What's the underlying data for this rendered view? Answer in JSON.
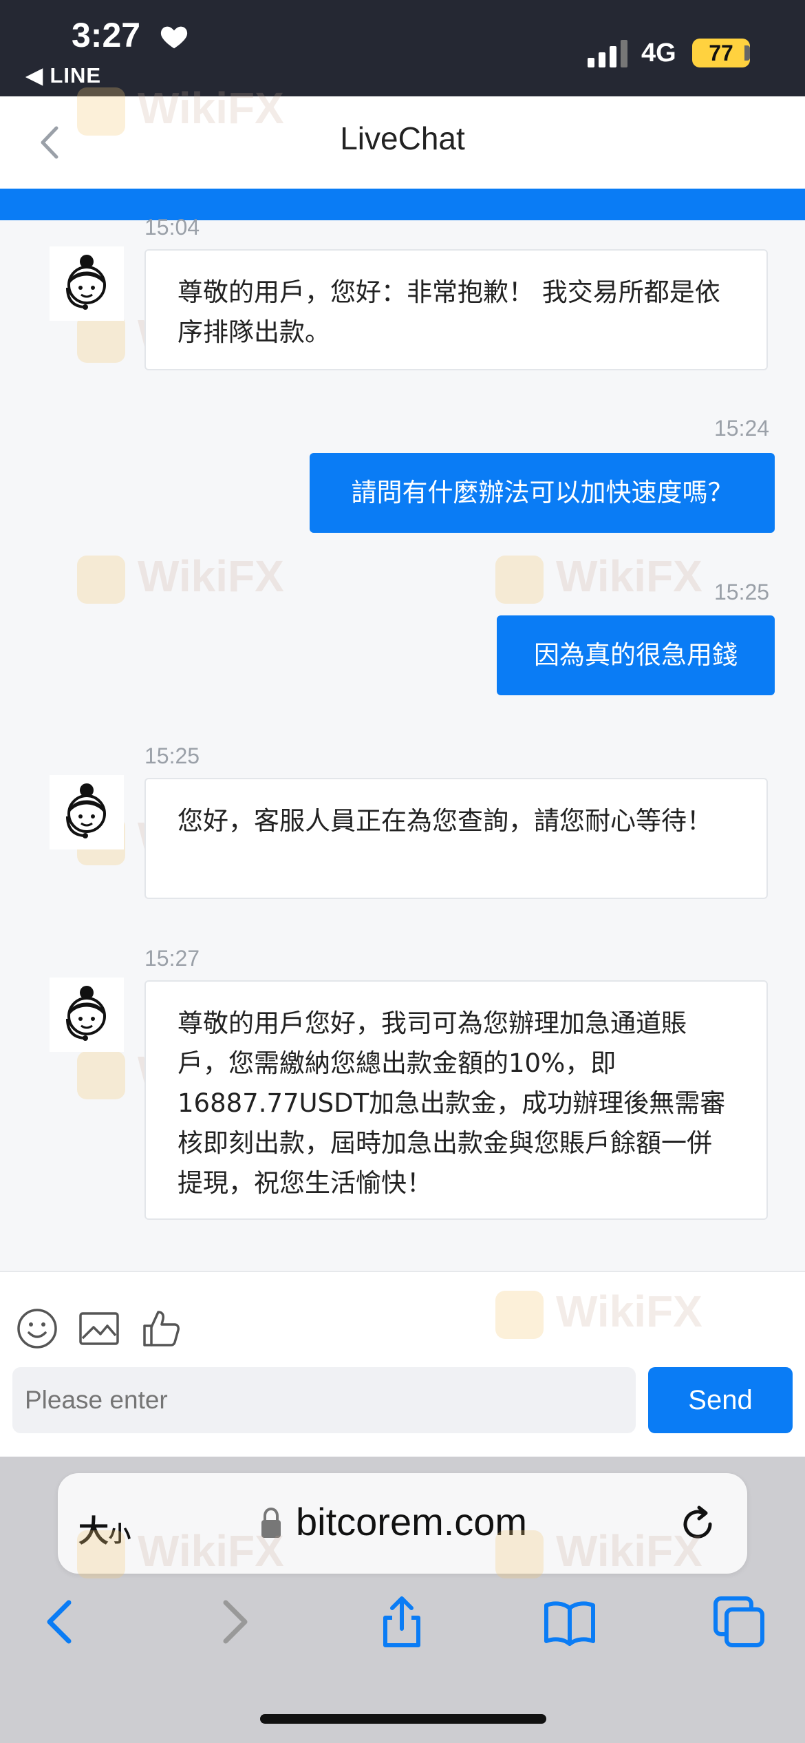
{
  "status_bar": {
    "time": "3:27",
    "back_app": "◀ LINE",
    "network": "4G",
    "battery": "77"
  },
  "header": {
    "title": "LiveChat"
  },
  "messages": [
    {
      "time": "15:04",
      "text": "尊敬的用戶，您好：非常抱歉！ 我交易所都是依序排隊出款。"
    },
    {
      "time": "15:24",
      "text": "請問有什麼辦法可以加快速度嗎？"
    },
    {
      "time": "15:25",
      "text": "因為真的很急用錢"
    },
    {
      "time": "15:25",
      "text": "您好，客服人員正在為您查詢，請您耐心等待！"
    },
    {
      "time": "15:27",
      "text": "尊敬的用戶您好，我司可為您辦理加急通道賬戶，您需繳納您總出款金額的10%，即16887.77USDT加急出款金，成功辦理後無需審核即刻出款，屆時加急出款金與您賬戶餘額一併提現，祝您生活愉快！"
    }
  ],
  "composer": {
    "placeholder": "Please enter",
    "send_label": "Send"
  },
  "browser": {
    "text_size_big": "大",
    "text_size_small": "小",
    "url": "bitcorem.com"
  },
  "watermark": {
    "text": "WikiFX"
  },
  "colors": {
    "accent": "#0a7cf5",
    "status_bar": "#252833",
    "battery": "#ffd23f"
  }
}
